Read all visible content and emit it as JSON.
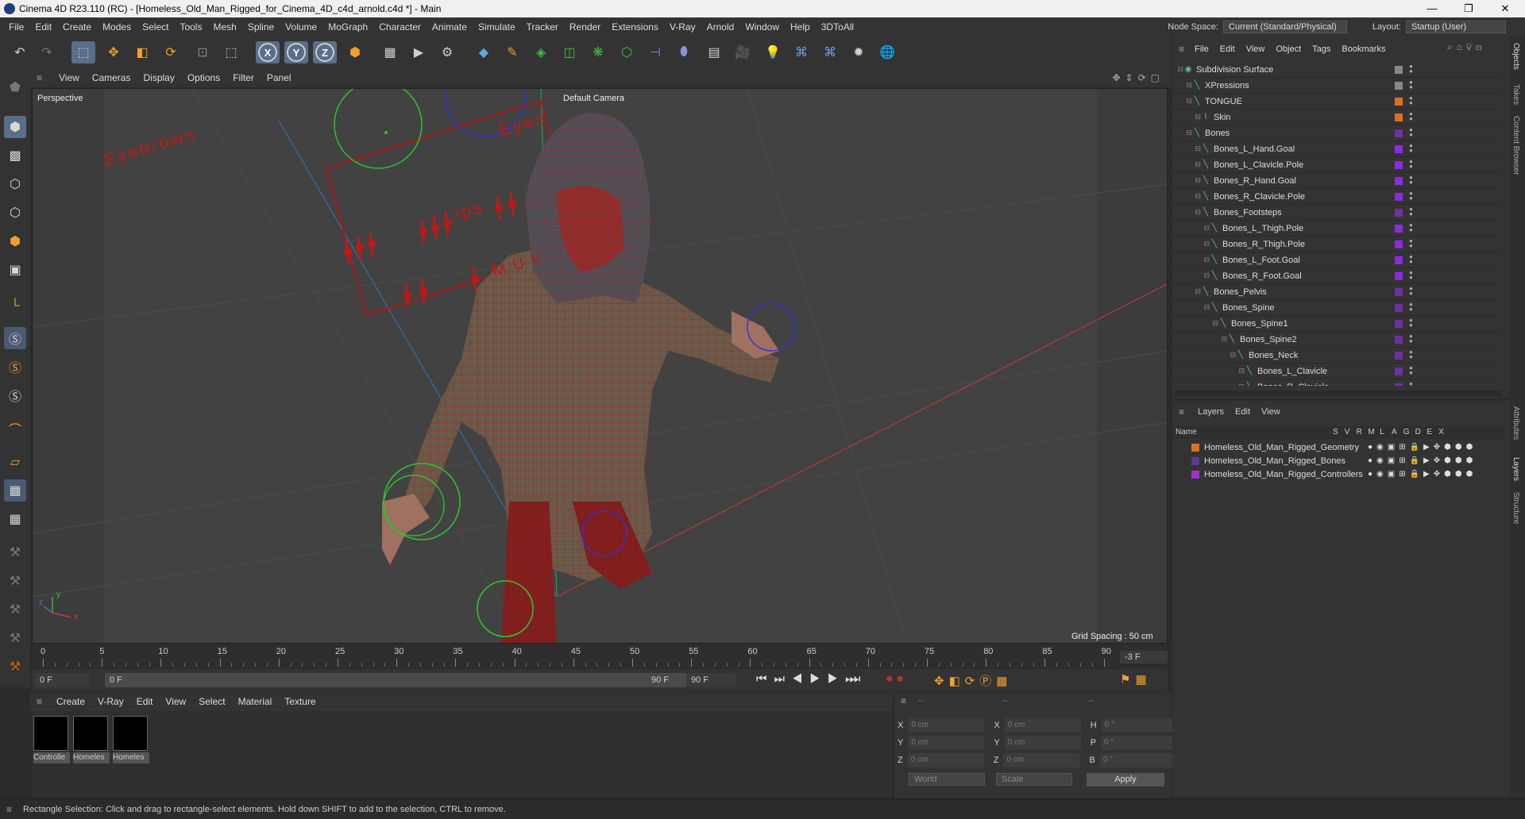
{
  "window": {
    "title": "Cinema 4D R23.110 (RC) - [Homeless_Old_Man_Rigged_for_Cinema_4D_c4d_arnold.c4d *] - Main",
    "minimize": "—",
    "maximize": "❐",
    "close": "✕"
  },
  "menubar": {
    "items": [
      "File",
      "Edit",
      "Create",
      "Modes",
      "Select",
      "Tools",
      "Mesh",
      "Spline",
      "Volume",
      "MoGraph",
      "Character",
      "Animate",
      "Simulate",
      "Tracker",
      "Render",
      "Extensions",
      "V-Ray",
      "Arnold",
      "Window",
      "Help",
      "3DToAll"
    ],
    "node_space_label": "Node Space:",
    "node_space_value": "Current (Standard/Physical)",
    "layout_label": "Layout:",
    "layout_value": "Startup (User)"
  },
  "toolbar": {
    "axis_x": "X",
    "axis_y": "Y",
    "axis_z": "Z"
  },
  "viewport": {
    "menu": [
      "View",
      "Cameras",
      "Display",
      "Options",
      "Filter",
      "Panel"
    ],
    "view_name": "Perspective",
    "camera": "Default Camera",
    "grid_spacing": "Grid Spacing : 50 cm",
    "controller_labels": {
      "eyebrows": "Eyebrows",
      "eyes": "Eyes",
      "lips": "Lips",
      "muv": "M U V"
    },
    "axis_labels": {
      "x": "x",
      "y": "y",
      "z": "z"
    }
  },
  "timeline": {
    "ticks": [
      "0",
      "5",
      "10",
      "15",
      "20",
      "25",
      "30",
      "35",
      "40",
      "45",
      "50",
      "55",
      "60",
      "65",
      "70",
      "75",
      "80",
      "85",
      "90"
    ],
    "current_frame": "-3 F",
    "start": "0 F",
    "range_start": "0 F",
    "range_end": "90 F",
    "end": "90 F"
  },
  "material_manager": {
    "menu": [
      "Create",
      "V-Ray",
      "Edit",
      "View",
      "Select",
      "Material",
      "Texture"
    ],
    "materials": [
      "Controlle",
      "Homeles",
      "Homeles"
    ]
  },
  "coordinates": {
    "header": [
      "--",
      "--",
      "--"
    ],
    "rows": [
      {
        "a": "X",
        "av": "0 cm",
        "b": "X",
        "bv": "0 cm",
        "c": "H",
        "cv": "0 °"
      },
      {
        "a": "Y",
        "av": "0 cm",
        "b": "Y",
        "bv": "0 cm",
        "c": "P",
        "cv": "0 °"
      },
      {
        "a": "Z",
        "av": "0 cm",
        "b": "Z",
        "bv": "0 cm",
        "c": "B",
        "cv": "0 °"
      }
    ],
    "mode": "World",
    "scale": "Scale",
    "apply": "Apply"
  },
  "object_manager": {
    "menu": [
      "File",
      "Edit",
      "View",
      "Object",
      "Tags",
      "Bookmarks"
    ],
    "objects": [
      {
        "name": "Subdivision Surface",
        "indent": 0,
        "color": "#888888"
      },
      {
        "name": "XPressions",
        "indent": 1,
        "color": "#888888"
      },
      {
        "name": "TONGUE",
        "indent": 1,
        "color": "#e07020"
      },
      {
        "name": "Skin",
        "indent": 2,
        "color": "#e07020"
      },
      {
        "name": "Bones",
        "indent": 1,
        "color": "#7030a0"
      },
      {
        "name": "Bones_L_Hand.Goal",
        "indent": 2,
        "color": "#8a2be2"
      },
      {
        "name": "Bones_L_Clavicle.Pole",
        "indent": 2,
        "color": "#8a2be2"
      },
      {
        "name": "Bones_R_Hand.Goal",
        "indent": 2,
        "color": "#8a2be2"
      },
      {
        "name": "Bones_R_Clavicle.Pole",
        "indent": 2,
        "color": "#8a2be2"
      },
      {
        "name": "Bones_Footsteps",
        "indent": 2,
        "color": "#7030a0"
      },
      {
        "name": "Bones_L_Thigh.Pole",
        "indent": 3,
        "color": "#8a2be2"
      },
      {
        "name": "Bones_R_Thigh.Pole",
        "indent": 3,
        "color": "#8a2be2"
      },
      {
        "name": "Bones_L_Foot.Goal",
        "indent": 3,
        "color": "#8a2be2"
      },
      {
        "name": "Bones_R_Foot.Goal",
        "indent": 3,
        "color": "#8a2be2"
      },
      {
        "name": "Bones_Pelvis",
        "indent": 2,
        "color": "#7030a0"
      },
      {
        "name": "Bones_Spine",
        "indent": 3,
        "color": "#7030a0"
      },
      {
        "name": "Bones_Spine1",
        "indent": 4,
        "color": "#7030a0"
      },
      {
        "name": "Bones_Spine2",
        "indent": 5,
        "color": "#7030a0"
      },
      {
        "name": "Bones_Neck",
        "indent": 6,
        "color": "#7030a0"
      },
      {
        "name": "Bones_L_Clavicle",
        "indent": 7,
        "color": "#7030a0"
      },
      {
        "name": "Bones_R_Clavicle",
        "indent": 7,
        "color": "#7030a0"
      }
    ]
  },
  "layer_manager": {
    "menu": [
      "Layers",
      "Edit",
      "View"
    ],
    "columns": [
      "Name",
      "S",
      "V",
      "R",
      "M",
      "L",
      "A",
      "G",
      "D",
      "E",
      "X"
    ],
    "layers": [
      {
        "name": "Homeless_Old_Man_Rigged_Geometry",
        "color": "#e07020"
      },
      {
        "name": "Homeless_Old_Man_Rigged_Bones",
        "color": "#5a3a8a"
      },
      {
        "name": "Homeless_Old_Man_Rigged_Controllers",
        "color": "#a030d0"
      }
    ]
  },
  "right_tabs": [
    "Objects",
    "Takes",
    "Content Browser",
    "Attributes",
    "Layers",
    "Structure"
  ],
  "status": "Rectangle Selection: Click and drag to rectangle-select elements. Hold down SHIFT to add to the selection, CTRL to remove."
}
